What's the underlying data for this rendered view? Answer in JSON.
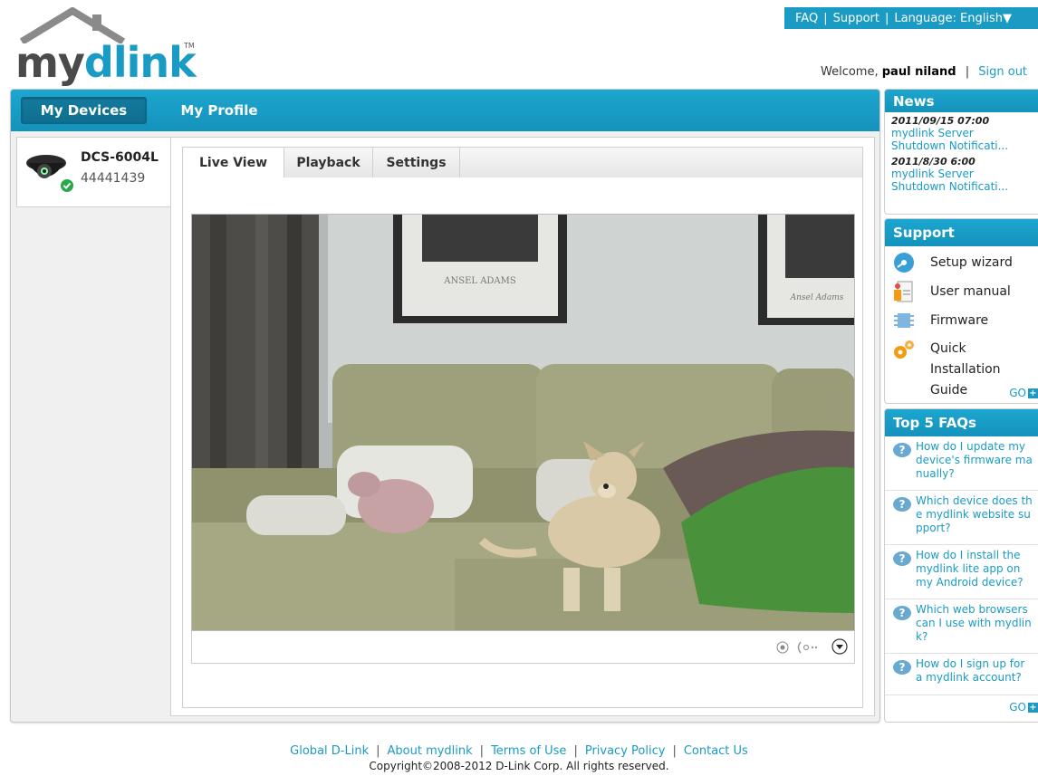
{
  "topbar": {
    "faq": "FAQ",
    "support": "Support",
    "language": "Language: English▼"
  },
  "logo": {
    "my": "my",
    "dlink": "dlink",
    "tm": "TM"
  },
  "welcome": {
    "prefix": "Welcome,",
    "user": "paul niland",
    "separator": "|",
    "signout": "Sign out"
  },
  "nav": {
    "my_devices": "My Devices",
    "my_profile": "My Profile"
  },
  "device": {
    "name": "DCS-6004L",
    "id": "44441439",
    "status": "online"
  },
  "tabs": {
    "live_view": "Live View",
    "playback": "Playback",
    "settings": "Settings"
  },
  "video": {
    "poster_left_text": "ANSEL ADAMS",
    "poster_right_text": "Ansel Adams"
  },
  "news": {
    "title": "News",
    "items": [
      {
        "date": "2011/09/15 07:00",
        "line1": "mydlink Server",
        "line2": "Shutdown Notificati..."
      },
      {
        "date": "2011/8/30 6:00",
        "line1": "mydlink Server",
        "line2": "Shutdown Notificati..."
      }
    ]
  },
  "support": {
    "title": "Support",
    "items": {
      "setup_wizard": "Setup wizard",
      "user_manual": "User manual",
      "firmware": "Firmware",
      "quick_install_1": "Quick Installation",
      "quick_install_2": "Guide"
    },
    "go": "GO"
  },
  "faqs": {
    "title": "Top 5 FAQs",
    "items": [
      {
        "l1": "How do I update my",
        "l2": "device's firmware ma",
        "l3": "nually?"
      },
      {
        "l1": "Which device does th",
        "l2": "e mydlink website su",
        "l3": "pport?"
      },
      {
        "l1": "How do I install the",
        "l2": "mydlink lite app on",
        "l3": "my Android device?"
      },
      {
        "l1": "Which web browsers",
        "l2": "can I use with mydlin",
        "l3": "k?"
      },
      {
        "l1": "How do I sign up for",
        "l2": "a mydlink account?",
        "l3": ""
      }
    ],
    "go": "GO"
  },
  "footer": {
    "links": {
      "global": "Global D-Link",
      "about": "About mydlink",
      "terms": "Terms of Use",
      "privacy": "Privacy Policy",
      "contact": "Contact Us"
    },
    "separator": "|",
    "copyright": "Copyright©2008-2012 D-Link Corp. All rights reserved."
  },
  "colors": {
    "accent": "#1a9bc4",
    "accent_dark": "#0f6e8f",
    "status_online": "#2aa84a"
  },
  "icons": {
    "topbar": [],
    "device": "camera-icon",
    "status": "check-icon",
    "support": [
      "disc-icon",
      "manual-icon",
      "chip-icon",
      "gears-icon"
    ],
    "faq": "question-icon",
    "go": "plus-icon",
    "video_controls": [
      "record-icon",
      "audio-icon",
      "dropdown-icon"
    ]
  }
}
